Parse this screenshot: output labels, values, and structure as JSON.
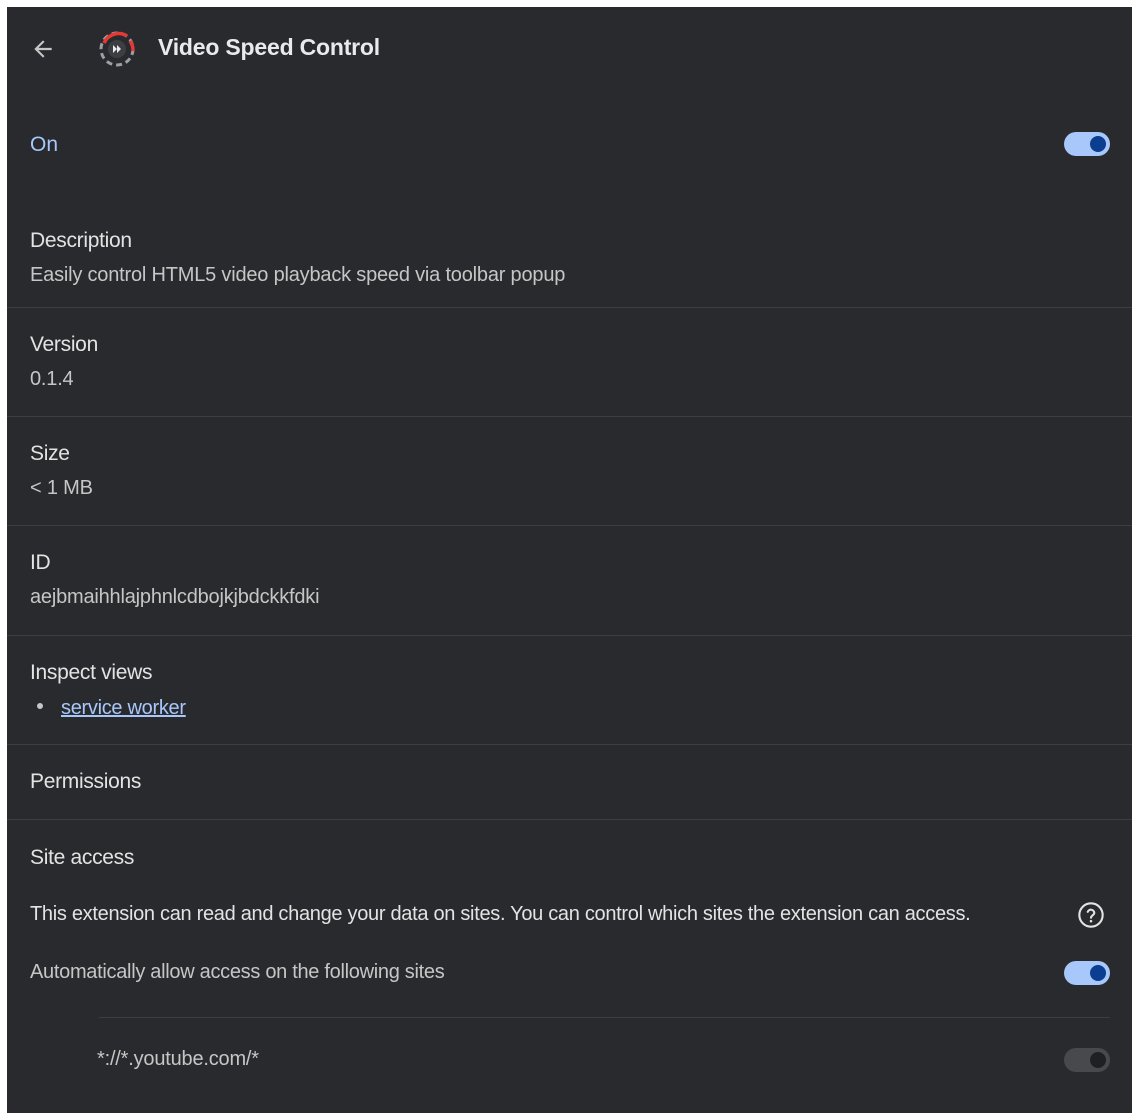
{
  "header": {
    "title": "Video Speed Control",
    "back_icon": "arrow-left-icon",
    "extension_icon": "video-speed-control-logo"
  },
  "status": {
    "label": "On",
    "enabled": true
  },
  "description": {
    "label": "Description",
    "value": "Easily control HTML5 video playback speed via toolbar popup"
  },
  "version": {
    "label": "Version",
    "value": "0.1.4"
  },
  "size": {
    "label": "Size",
    "value": "< 1 MB"
  },
  "id": {
    "label": "ID",
    "value": "aejbmaihhlajphnlcdbojkjbdckkfdki"
  },
  "inspect_views": {
    "label": "Inspect views",
    "items": [
      {
        "label": "service worker"
      }
    ]
  },
  "permissions": {
    "label": "Permissions"
  },
  "site_access": {
    "label": "Site access",
    "description": "This extension can read and change your data on sites. You can control which sites the extension can access.",
    "help_icon": "help-circle-icon",
    "auto_allow_label": "Automatically allow access on the following sites",
    "auto_allow_enabled": true,
    "sites": [
      {
        "pattern": "*://*.youtube.com/*",
        "enabled": false
      }
    ]
  },
  "colors": {
    "background": "#282a2e",
    "accent": "#a8c7fa",
    "toggle_knob": "#0b3d91",
    "text": "#e3e3e3",
    "secondary_text": "#c4c7c5",
    "divider": "#3c3e42"
  }
}
